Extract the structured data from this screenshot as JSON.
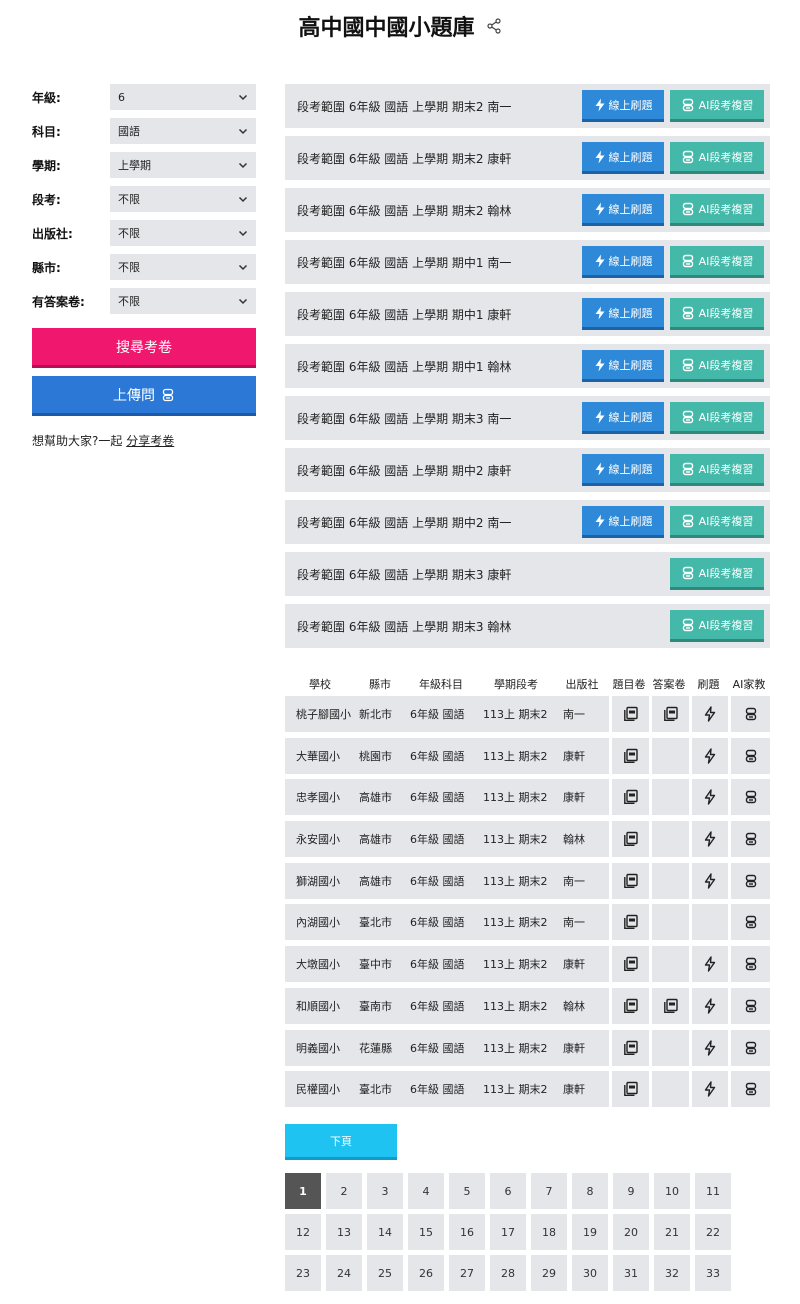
{
  "header": {
    "title": "高中國中國小題庫"
  },
  "filters": [
    {
      "label": "年級:",
      "value": "6"
    },
    {
      "label": "科目:",
      "value": "國語"
    },
    {
      "label": "學期:",
      "value": "上學期"
    },
    {
      "label": "段考:",
      "value": "不限"
    },
    {
      "label": "出版社:",
      "value": "不限"
    },
    {
      "label": "縣市:",
      "value": "不限"
    },
    {
      "label": "有答案卷:",
      "value": "不限"
    }
  ],
  "sidebar": {
    "search_label": "搜尋考卷",
    "upload_label": "上傳問",
    "help_prefix": "想幫助大家?一起",
    "help_link": "分享考卷"
  },
  "exams": [
    {
      "title": "段考範圍 6年級 國語 上學期 期末2 南一",
      "online": true
    },
    {
      "title": "段考範圍 6年級 國語 上學期 期末2 康軒",
      "online": true
    },
    {
      "title": "段考範圍 6年級 國語 上學期 期末2 翰林",
      "online": true
    },
    {
      "title": "段考範圍 6年級 國語 上學期 期中1 南一",
      "online": true
    },
    {
      "title": "段考範圍 6年級 國語 上學期 期中1 康軒",
      "online": true
    },
    {
      "title": "段考範圍 6年級 國語 上學期 期中1 翰林",
      "online": true
    },
    {
      "title": "段考範圍 6年級 國語 上學期 期末3 南一",
      "online": true
    },
    {
      "title": "段考範圍 6年級 國語 上學期 期中2 康軒",
      "online": true
    },
    {
      "title": "段考範圍 6年級 國語 上學期 期中2 南一",
      "online": true
    },
    {
      "title": "段考範圍 6年級 國語 上學期 期末3 康軒",
      "online": false
    },
    {
      "title": "段考範圍 6年級 國語 上學期 期末3 翰林",
      "online": false
    }
  ],
  "exam_buttons": {
    "online_label": "線上刷題",
    "ai_label": "AI段考複習"
  },
  "table": {
    "headers": [
      "學校",
      "縣市",
      "年級科目",
      "學期段考",
      "出版社",
      "題目卷",
      "答案卷",
      "刷題",
      "AI家教"
    ],
    "rows": [
      {
        "school": "桃子腳國小",
        "city": "新北市",
        "grade": "6年級 國語",
        "sem": "113上 期末2",
        "pub": "南一",
        "q": true,
        "a": true,
        "drill": true,
        "ai": true
      },
      {
        "school": "大華國小",
        "city": "桃園市",
        "grade": "6年級 國語",
        "sem": "113上 期末2",
        "pub": "康軒",
        "q": true,
        "a": false,
        "drill": true,
        "ai": true
      },
      {
        "school": "忠孝國小",
        "city": "高雄市",
        "grade": "6年級 國語",
        "sem": "113上 期末2",
        "pub": "康軒",
        "q": true,
        "a": false,
        "drill": true,
        "ai": true
      },
      {
        "school": "永安國小",
        "city": "高雄市",
        "grade": "6年級 國語",
        "sem": "113上 期末2",
        "pub": "翰林",
        "q": true,
        "a": false,
        "drill": true,
        "ai": true
      },
      {
        "school": "獅湖國小",
        "city": "高雄市",
        "grade": "6年級 國語",
        "sem": "113上 期末2",
        "pub": "南一",
        "q": true,
        "a": false,
        "drill": true,
        "ai": true
      },
      {
        "school": "內湖國小",
        "city": "臺北市",
        "grade": "6年級 國語",
        "sem": "113上 期末2",
        "pub": "南一",
        "q": true,
        "a": false,
        "drill": false,
        "ai": true
      },
      {
        "school": "大墩國小",
        "city": "臺中市",
        "grade": "6年級 國語",
        "sem": "113上 期末2",
        "pub": "康軒",
        "q": true,
        "a": false,
        "drill": true,
        "ai": true
      },
      {
        "school": "和順國小",
        "city": "臺南市",
        "grade": "6年級 國語",
        "sem": "113上 期末2",
        "pub": "翰林",
        "q": true,
        "a": true,
        "drill": true,
        "ai": true
      },
      {
        "school": "明義國小",
        "city": "花蓮縣",
        "grade": "6年級 國語",
        "sem": "113上 期末2",
        "pub": "康軒",
        "q": true,
        "a": false,
        "drill": true,
        "ai": true
      },
      {
        "school": "民權國小",
        "city": "臺北市",
        "grade": "6年級 國語",
        "sem": "113上 期末2",
        "pub": "康軒",
        "q": true,
        "a": false,
        "drill": true,
        "ai": true
      }
    ]
  },
  "next_label": "下頁",
  "pager": {
    "current": "1",
    "pages": [
      "1",
      "2",
      "3",
      "4",
      "5",
      "6",
      "7",
      "8",
      "9",
      "10",
      "11",
      "12",
      "13",
      "14",
      "15",
      "16",
      "17",
      "18",
      "19",
      "20",
      "21",
      "22",
      "23",
      "24",
      "25",
      "26",
      "27",
      "28",
      "29",
      "30",
      "31",
      "32",
      "33"
    ]
  },
  "colors": {
    "search": "#f0186e",
    "upload": "#2b78d6",
    "online": "#2e89d8",
    "ai": "#45b9a9",
    "next": "#1ec3f2",
    "row_bg": "#e4e6ea"
  },
  "icons": {
    "share": "share-icon",
    "chevron": "chevron-down-icon",
    "bolt": "lightning-icon",
    "robot": "robot-icon",
    "pdf": "pdf-icon"
  }
}
